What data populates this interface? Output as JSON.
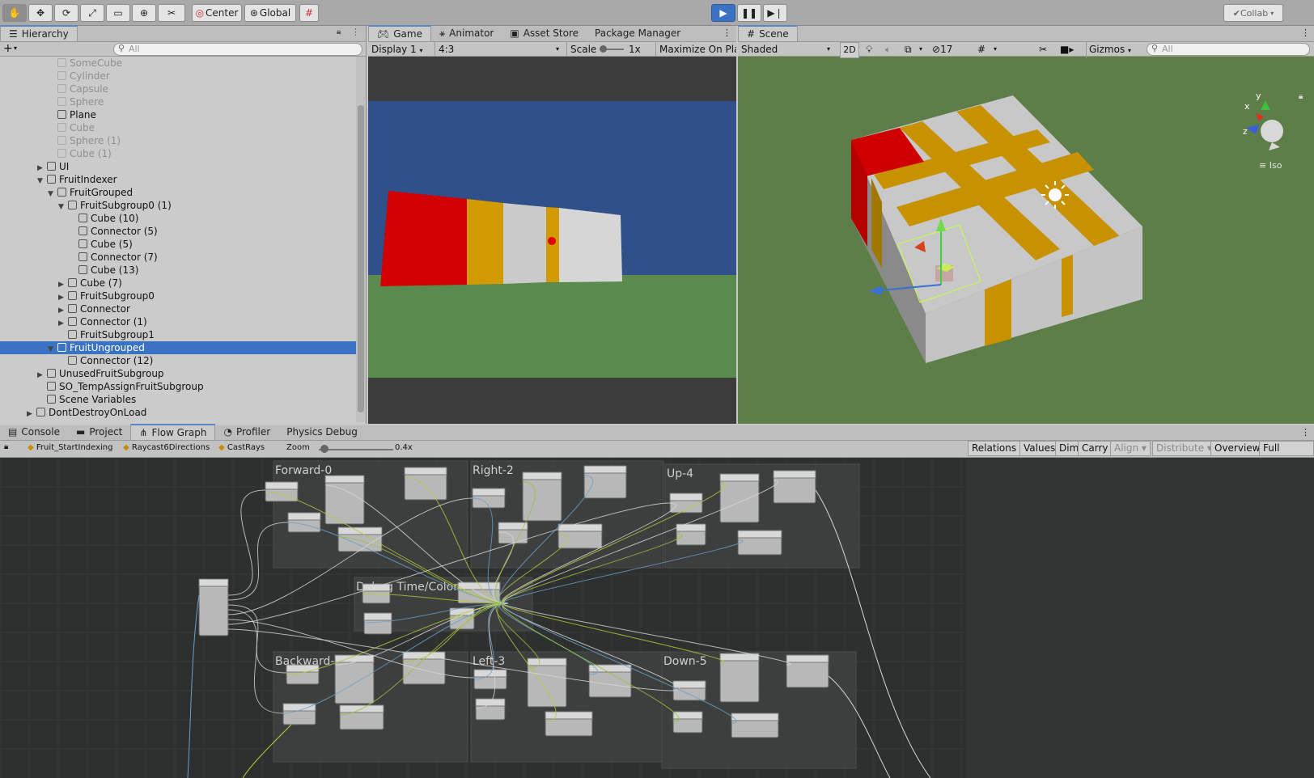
{
  "toolbar": {
    "tools": [
      "hand-tool",
      "move-tool",
      "rotate-tool",
      "scale-tool",
      "rect-tool",
      "transform-tool",
      "custom-tool"
    ],
    "pivot": "Center",
    "space": "Global",
    "collab": "Collab"
  },
  "hierarchy": {
    "title": "Hierarchy",
    "search_placeholder": "All",
    "rows": [
      {
        "label": "SomeCube",
        "dim": true,
        "indent": 1
      },
      {
        "label": "Cylinder",
        "dim": true,
        "indent": 1
      },
      {
        "label": "Capsule",
        "dim": true,
        "indent": 1
      },
      {
        "label": "Sphere",
        "dim": true,
        "indent": 1
      },
      {
        "label": "Plane",
        "dim": false,
        "indent": 1
      },
      {
        "label": "Cube",
        "dim": true,
        "indent": 1
      },
      {
        "label": "Sphere (1)",
        "dim": true,
        "indent": 1
      },
      {
        "label": "Cube (1)",
        "dim": true,
        "indent": 1
      },
      {
        "label": "UI",
        "dim": false,
        "indent": 0,
        "arrow": "▶"
      },
      {
        "label": "FruitIndexer",
        "dim": false,
        "indent": 0,
        "arrow": "▼"
      },
      {
        "label": "FruitGrouped",
        "dim": false,
        "indent": 1,
        "arrow": "▼"
      },
      {
        "label": "FruitSubgroup0 (1)",
        "dim": false,
        "indent": 2,
        "arrow": "▼"
      },
      {
        "label": "Cube (10)",
        "dim": false,
        "indent": 3
      },
      {
        "label": "Connector (5)",
        "dim": false,
        "indent": 3
      },
      {
        "label": "Cube (5)",
        "dim": false,
        "indent": 3
      },
      {
        "label": "Connector (7)",
        "dim": false,
        "indent": 3
      },
      {
        "label": "Cube (13)",
        "dim": false,
        "indent": 3
      },
      {
        "label": "Cube (7)",
        "dim": false,
        "indent": 2,
        "arrow": "▶"
      },
      {
        "label": "FruitSubgroup0",
        "dim": false,
        "indent": 2,
        "arrow": "▶"
      },
      {
        "label": "Connector",
        "dim": false,
        "indent": 2,
        "arrow": "▶"
      },
      {
        "label": "Connector (1)",
        "dim": false,
        "indent": 2,
        "arrow": "▶"
      },
      {
        "label": "FruitSubgroup1",
        "dim": false,
        "indent": 2
      },
      {
        "label": "FruitUngrouped",
        "dim": false,
        "indent": 1,
        "arrow": "▼",
        "selected": true
      },
      {
        "label": "Connector (12)",
        "dim": false,
        "indent": 2
      },
      {
        "label": "UnusedFruitSubgroup",
        "dim": false,
        "indent": 0,
        "arrow": "▶"
      },
      {
        "label": "SO_TempAssignFruitSubgroup",
        "dim": false,
        "indent": 0
      },
      {
        "label": "Scene Variables",
        "dim": false,
        "indent": 0
      },
      {
        "label": "DontDestroyOnLoad",
        "dim": false,
        "indent": -1,
        "arrow": "▶"
      }
    ]
  },
  "game": {
    "tabs": [
      "Game",
      "Animator",
      "Asset Store",
      "Package Manager"
    ],
    "display": "Display 1",
    "aspect": "4:3",
    "scale_label": "Scale",
    "scale_value": "1x",
    "maximize": "Maximize On Pla"
  },
  "scene": {
    "tab": "Scene",
    "shading": "Shaded",
    "mode_2d": "2D",
    "hidden_count": "17",
    "gizmos": "Gizmos",
    "search_placeholder": "All",
    "projection": "Iso",
    "axes": [
      "y",
      "x",
      "z"
    ]
  },
  "bottom": {
    "tabs": [
      "Console",
      "Project",
      "Flow Graph",
      "Profiler",
      "Physics Debug"
    ],
    "breadcrumbs": [
      "Fruit_StartIndexing",
      "Raycast6Directions",
      "CastRays"
    ],
    "zoom_label": "Zoom",
    "zoom_value": "0.4x",
    "buttons": [
      {
        "label": "Relations",
        "off": false
      },
      {
        "label": "Values",
        "off": false
      },
      {
        "label": "Dim",
        "off": false
      },
      {
        "label": "Carry",
        "off": false
      },
      {
        "label": "Align ▾",
        "off": true
      },
      {
        "label": "Distribute ▾",
        "off": true
      },
      {
        "label": "Overview",
        "off": false
      },
      {
        "label": "Full Screen",
        "off": false
      }
    ],
    "groups": [
      "Forward-0",
      "Right-2",
      "Up-4",
      "Debug Time/Color",
      "Backward-1",
      "Left-3",
      "Down-5"
    ]
  },
  "colors": {
    "sky": "#2f5088",
    "ground": "#5b8a4f",
    "red": "#d20000",
    "gold": "#d09a00",
    "grey": "#c9c9c9",
    "selection": "#3a73c4",
    "play_active": "#3a73c4"
  }
}
